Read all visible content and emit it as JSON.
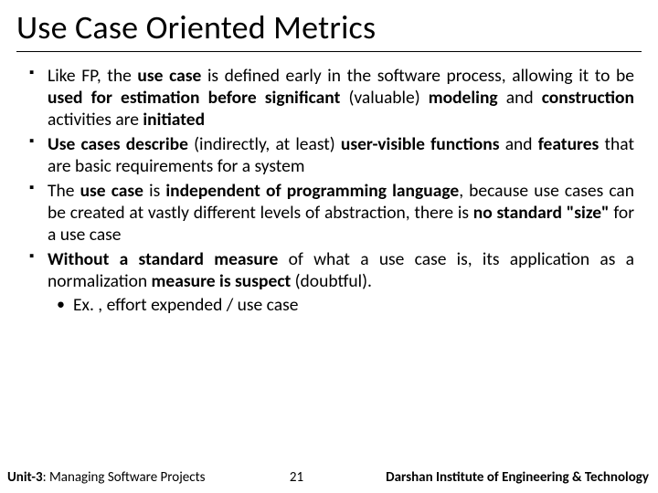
{
  "title": "Use Case Oriented Metrics",
  "bullets": [
    {
      "pre": "Like FP, the ",
      "b1": "use case",
      "mid1": " is defined early in the software process, allowing it to be ",
      "b2": "used for estimation before significant",
      "mid2": " (valuable) ",
      "b3": "modeling",
      "mid3": " and ",
      "b4": "construction",
      "mid4": " activities are ",
      "b5": "initiated",
      "post": ""
    },
    {
      "b1": "Use cases describe",
      "mid1": " (indirectly, at least) ",
      "b2": "user-visible functions",
      "mid2": " and ",
      "b3": "features",
      "post": " that are basic requirements for a system"
    },
    {
      "pre": "The ",
      "b1": "use case",
      "mid1": " is ",
      "b2": "independent of programming language",
      "mid2": ", because use cases can be created at vastly different levels of abstraction, there is ",
      "b3": "no standard \"size\"",
      "post": " for a use case"
    },
    {
      "b1": "Without a standard measure",
      "mid1": " of what a use case is, its application as a normalization ",
      "b2": "measure is suspect",
      "post": " (doubtful).",
      "sub": "Ex. , effort expended / use case"
    }
  ],
  "footer": {
    "unit_prefix": "Unit-3",
    "unit_rest": ": Managing Software Projects",
    "page": "21",
    "institute": "Darshan Institute of Engineering & Technology"
  }
}
